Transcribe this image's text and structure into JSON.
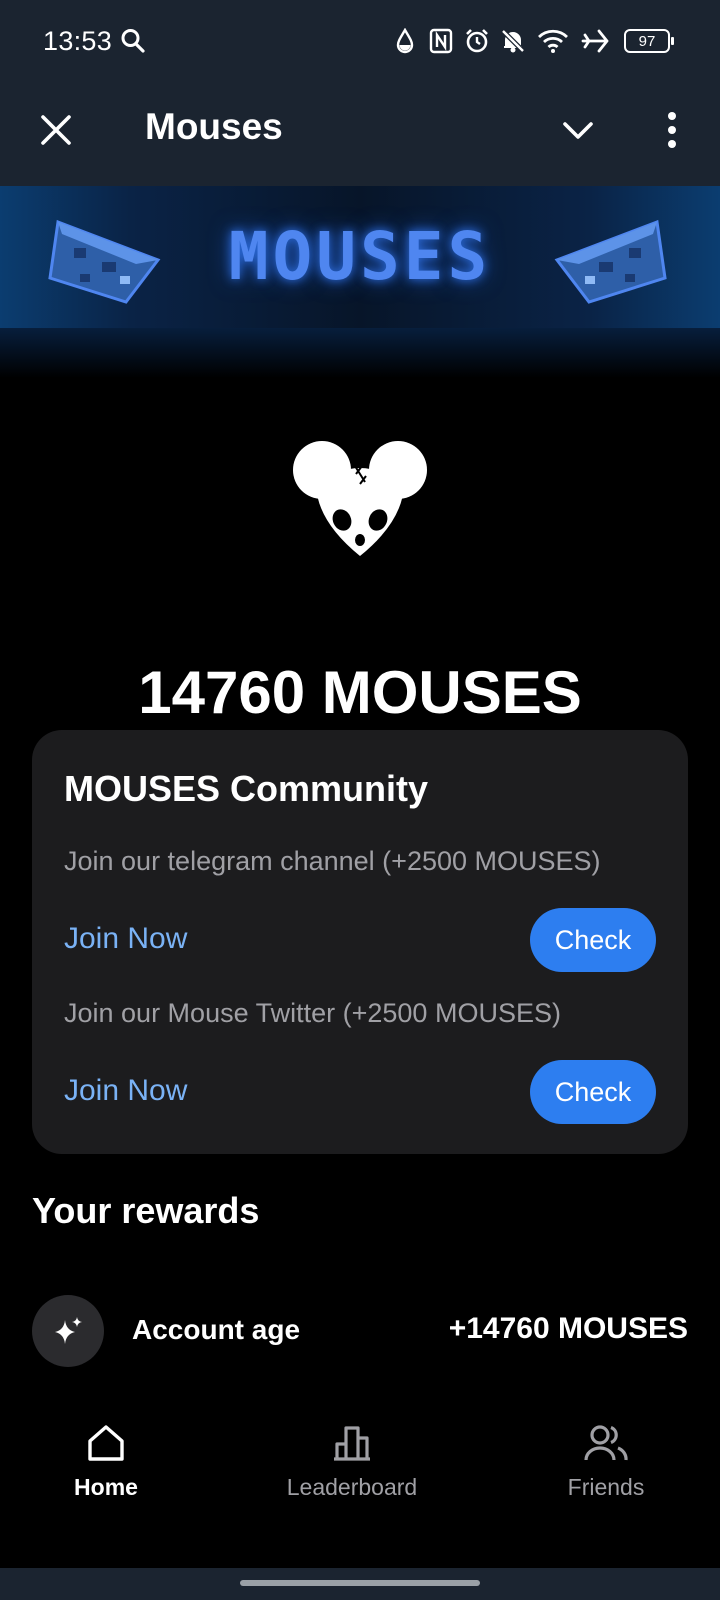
{
  "status_bar": {
    "time": "13:53",
    "battery": "97",
    "icons": [
      "search-icon",
      "water-drop-icon",
      "nfc-icon",
      "alarm-icon",
      "bell-off-icon",
      "wifi-icon",
      "airplane-icon",
      "battery-icon"
    ]
  },
  "app_bar": {
    "title": "Mouses",
    "icons": [
      "close-icon",
      "chevron-down-icon",
      "more-vert-icon"
    ]
  },
  "banner": {
    "text": "MOUSES"
  },
  "balance": {
    "total": "14760 MOUSES"
  },
  "community": {
    "title": "MOUSES Community",
    "tasks": [
      {
        "description": "Join our telegram channel (+2500 MOUSES)",
        "link_label": "Join Now",
        "button_label": "Check"
      },
      {
        "description": "Join our Mouse Twitter (+2500 MOUSES)",
        "link_label": "Join Now",
        "button_label": "Check"
      }
    ]
  },
  "rewards": {
    "title": "Your rewards",
    "items": [
      {
        "label": "Account age",
        "value": "+14760 MOUSES",
        "icon": "sparkles-icon"
      }
    ]
  },
  "bottom_nav": {
    "items": [
      {
        "label": "Home",
        "icon": "home-icon",
        "active": true
      },
      {
        "label": "Leaderboard",
        "icon": "leaderboard-icon",
        "active": false
      },
      {
        "label": "Friends",
        "icon": "friends-icon",
        "active": false
      }
    ]
  },
  "colors": {
    "accent": "#2d7ef0",
    "link": "#7ab2f5",
    "header_bg": "#1b2430",
    "card_bg": "#1c1c1e",
    "banner_glow": "#4f86f0"
  }
}
